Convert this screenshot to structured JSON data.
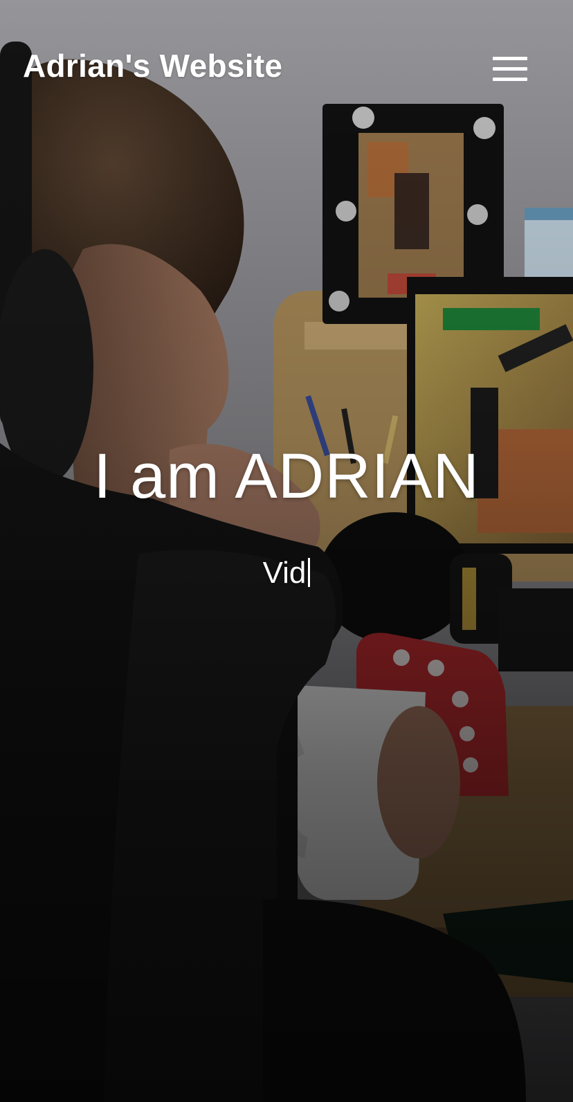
{
  "header": {
    "site_title": "Adrian's Website",
    "menu_icon": "hamburger-menu-icon"
  },
  "hero": {
    "heading": "I am ADRIAN",
    "typed_text": "Vid"
  },
  "background": {
    "image_description_icon": "hero-background-photo",
    "overlay_color": "#000000"
  },
  "colors": {
    "text": "#ffffff",
    "wall": "#9b9ba0",
    "desk_wood": "#c9a46a",
    "mug": "#e6e6e6",
    "plush_red": "#b8282c"
  }
}
